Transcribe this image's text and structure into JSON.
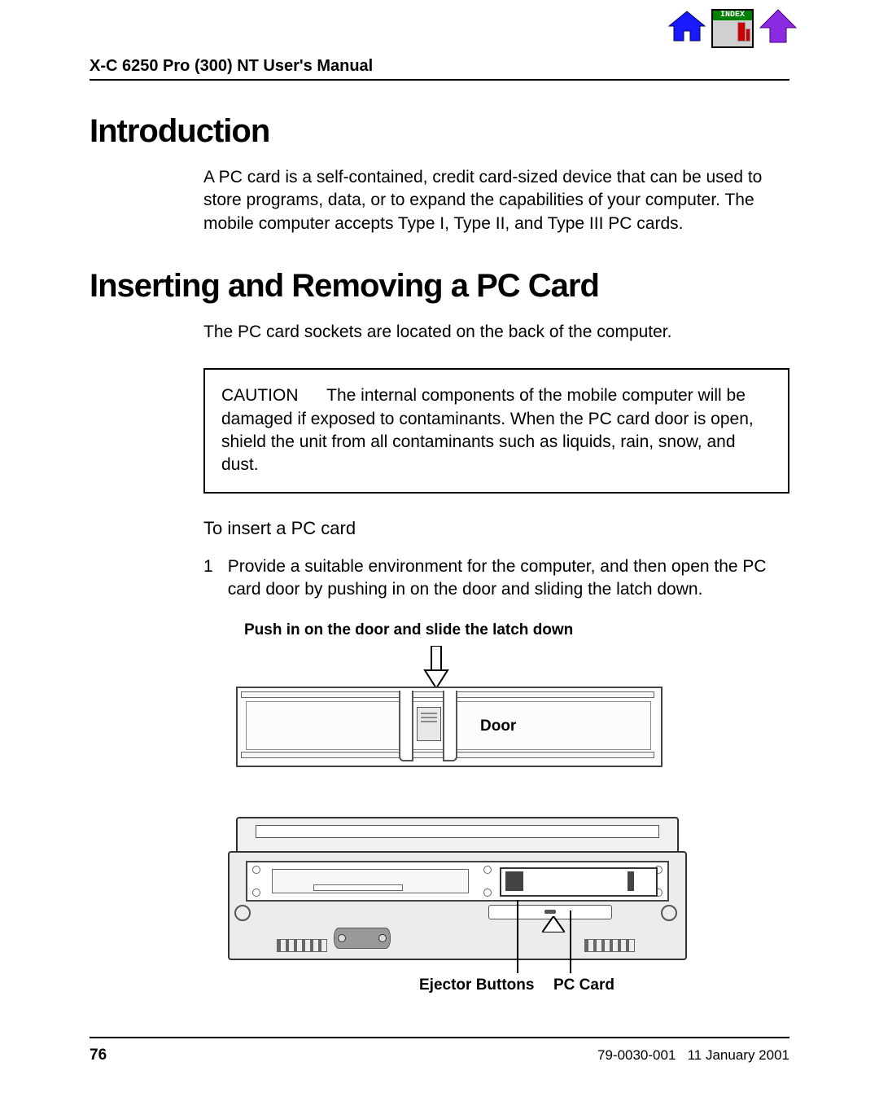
{
  "header": {
    "title": "X-C 6250 Pro (300) NT User's Manual",
    "index_label": "INDEX"
  },
  "sections": {
    "intro_heading": "Introduction",
    "intro_body": "A PC card is a self-contained, credit card-sized device that can be used to store programs, data, or to expand the capabilities of your computer. The mobile computer accepts Type I, Type II, and Type III PC cards.",
    "insert_heading": "Inserting and Removing a PC Card",
    "insert_body": "The PC card sockets are located on the back of the computer.",
    "caution_label": "CAUTION",
    "caution_body": "The internal components of the mobile computer will be damaged if exposed to contaminants. When the PC card door is open, shield the unit from all contaminants such as liquids, rain, snow, and dust.",
    "subhead": "To insert a PC card",
    "step1_num": "1",
    "step1_text": "Provide a suitable environment for the computer, and then open the PC card door by pushing in on the door and sliding the latch down."
  },
  "figures": {
    "fig1_caption": "Push in on the door and slide the latch down",
    "fig1_door_label": "Door",
    "fig2_ejector_label": "Ejector Buttons",
    "fig2_pccard_label": "PC Card"
  },
  "footer": {
    "page": "76",
    "docid": "79-0030-001",
    "date": "11 January 2001"
  }
}
